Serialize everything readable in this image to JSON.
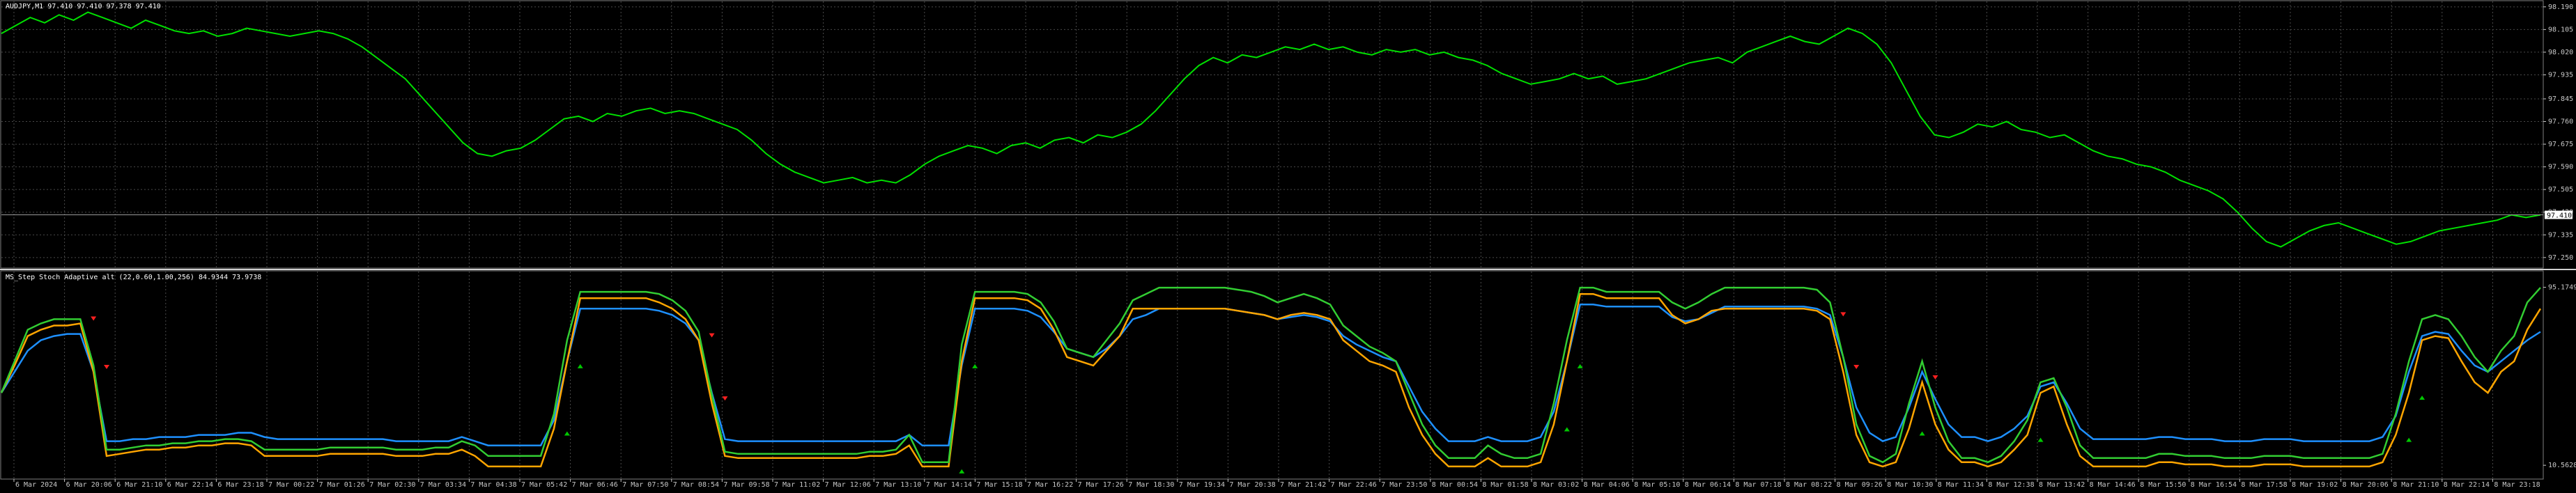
{
  "colors": {
    "background": "#000000",
    "grid": "#4a4a4a",
    "axis_text": "#c8c8c8",
    "price_line": "#00e000",
    "price_marker": "#ffffff",
    "stoch_orange": "#ffa500",
    "stoch_green": "#32cd32",
    "stoch_blue": "#1e90ff",
    "arrow_red": "#ff2020",
    "arrow_green": "#00c800"
  },
  "chart_data": [
    {
      "type": "line",
      "title": "AUDJPY,M1  97.410 97.410 97.378 97.410",
      "symbol": "AUDJPY,M1",
      "ohlc": [
        "97.410",
        "97.410",
        "97.378",
        "97.410"
      ],
      "current_price_label": "97.410",
      "y_ticks": [
        "98.190",
        "98.105",
        "98.020",
        "97.935",
        "97.845",
        "97.760",
        "97.675",
        "97.590",
        "97.505",
        "97.420",
        "97.335",
        "97.250"
      ],
      "ylim": [
        97.213,
        98.2
      ],
      "grid": true,
      "series": [
        {
          "values": [
            98.09,
            98.12,
            98.15,
            98.13,
            98.16,
            98.14,
            98.17,
            98.15,
            98.13,
            98.11,
            98.14,
            98.12,
            98.1,
            98.09,
            98.1,
            98.08,
            98.09,
            98.11,
            98.1,
            98.09,
            98.08,
            98.09,
            98.1,
            98.09,
            98.07,
            98.04,
            98.0,
            97.96,
            97.92,
            97.86,
            97.8,
            97.74,
            97.68,
            97.64,
            97.63,
            97.65,
            97.66,
            97.69,
            97.73,
            97.77,
            97.78,
            97.76,
            97.79,
            97.78,
            97.8,
            97.81,
            97.79,
            97.8,
            97.79,
            97.77,
            97.75,
            97.73,
            97.69,
            97.64,
            97.6,
            97.57,
            97.55,
            97.53,
            97.54,
            97.55,
            97.53,
            97.54,
            97.53,
            97.56,
            97.6,
            97.63,
            97.65,
            97.67,
            97.66,
            97.64,
            97.67,
            97.68,
            97.66,
            97.69,
            97.7,
            97.68,
            97.71,
            97.7,
            97.72,
            97.75,
            97.8,
            97.86,
            97.92,
            97.97,
            98.0,
            97.98,
            98.01,
            98.0,
            98.02,
            98.04,
            98.03,
            98.05,
            98.03,
            98.04,
            98.02,
            98.01,
            98.03,
            98.02,
            98.03,
            98.01,
            98.02,
            98.0,
            97.99,
            97.97,
            97.94,
            97.92,
            97.9,
            97.91,
            97.92,
            97.94,
            97.92,
            97.93,
            97.9,
            97.91,
            97.92,
            97.94,
            97.96,
            97.98,
            97.99,
            98.0,
            97.98,
            98.02,
            98.04,
            98.06,
            98.08,
            98.06,
            98.05,
            98.08,
            98.11,
            98.09,
            98.05,
            97.98,
            97.88,
            97.78,
            97.71,
            97.7,
            97.72,
            97.75,
            97.74,
            97.76,
            97.73,
            97.72,
            97.7,
            97.71,
            97.68,
            97.65,
            97.63,
            97.62,
            97.6,
            97.59,
            97.57,
            97.54,
            97.52,
            97.5,
            97.47,
            97.42,
            97.36,
            97.31,
            97.29,
            97.32,
            97.35,
            97.37,
            97.38,
            97.36,
            97.34,
            97.32,
            97.3,
            97.31,
            97.33,
            97.35,
            97.36,
            97.37,
            97.38,
            97.39,
            97.41,
            97.4,
            97.41
          ]
        }
      ]
    },
    {
      "type": "line",
      "title": "MS_Step Stoch Adaptive alt (22,0.60,1.00,256) 84.9344 73.9738",
      "indicator_name": "MS_Step Stoch Adaptive alt",
      "params": "(22,0.60,1.00,256)",
      "values_label": [
        "84.9344",
        "73.9738"
      ],
      "y_ticks": [
        "95.1749",
        "10.5628"
      ],
      "ylim": [
        4,
        100
      ],
      "grid": true,
      "x_labels": [
        "6 Mar 2024",
        "6 Mar 20:06",
        "6 Mar 21:10",
        "6 Mar 22:14",
        "6 Mar 23:18",
        "7 Mar 00:22",
        "7 Mar 01:26",
        "7 Mar 02:30",
        "7 Mar 03:34",
        "7 Mar 04:38",
        "7 Mar 05:42",
        "7 Mar 06:46",
        "7 Mar 07:50",
        "7 Mar 08:54",
        "7 Mar 09:58",
        "7 Mar 11:02",
        "7 Mar 12:06",
        "7 Mar 13:10",
        "7 Mar 14:14",
        "7 Mar 15:18",
        "7 Mar 16:22",
        "7 Mar 17:26",
        "7 Mar 18:30",
        "7 Mar 19:34",
        "7 Mar 20:38",
        "7 Mar 21:42",
        "7 Mar 22:46",
        "7 Mar 23:50",
        "8 Mar 00:54",
        "8 Mar 01:58",
        "8 Mar 03:02",
        "8 Mar 04:06",
        "8 Mar 05:10",
        "8 Mar 06:14",
        "8 Mar 07:18",
        "8 Mar 08:22",
        "8 Mar 09:26",
        "8 Mar 10:30",
        "8 Mar 11:34",
        "8 Mar 12:38",
        "8 Mar 13:42",
        "8 Mar 14:46",
        "8 Mar 15:50",
        "8 Mar 16:54",
        "8 Mar 17:58",
        "8 Mar 19:02",
        "8 Mar 20:06",
        "8 Mar 21:10",
        "8 Mar 22:14",
        "8 Mar 23:18"
      ],
      "series": [
        {
          "values": [
            45,
            58,
            72,
            75,
            77,
            77,
            78,
            55,
            15,
            16,
            17,
            18,
            18,
            19,
            19,
            20,
            20,
            21,
            21,
            20,
            15,
            15,
            15,
            15,
            15,
            16,
            16,
            16,
            16,
            16,
            15,
            15,
            15,
            16,
            16,
            18,
            15,
            10,
            10,
            10,
            10,
            10,
            28,
            60,
            90,
            90,
            90,
            90,
            90,
            90,
            88,
            85,
            80,
            70,
            40,
            15,
            14,
            14,
            14,
            14,
            14,
            14,
            14,
            14,
            14,
            14,
            15,
            15,
            16,
            20,
            10,
            10,
            10,
            60,
            90,
            90,
            90,
            90,
            89,
            85,
            75,
            62,
            60,
            58,
            65,
            72,
            85,
            85,
            85,
            85,
            85,
            85,
            85,
            85,
            84,
            83,
            82,
            80,
            82,
            83,
            82,
            80,
            70,
            65,
            60,
            58,
            55,
            38,
            25,
            16,
            10,
            10,
            10,
            14,
            10,
            10,
            10,
            12,
            30,
            60,
            92,
            92,
            90,
            90,
            90,
            90,
            90,
            82,
            78,
            80,
            84,
            85,
            85,
            85,
            85,
            85,
            85,
            85,
            84,
            80,
            55,
            25,
            12,
            10,
            12,
            28,
            50,
            30,
            18,
            12,
            12,
            10,
            12,
            18,
            25,
            45,
            48,
            30,
            15,
            10,
            10,
            10,
            10,
            10,
            12,
            12,
            11,
            11,
            11,
            10,
            10,
            10,
            11,
            11,
            11,
            10,
            10,
            10,
            10,
            10,
            10,
            12,
            25,
            45,
            70,
            72,
            71,
            60,
            50,
            45,
            55,
            60,
            75,
            85
          ]
        },
        {
          "values": [
            45,
            60,
            75,
            78,
            80,
            80,
            80,
            58,
            18,
            18,
            19,
            20,
            20,
            21,
            21,
            22,
            22,
            23,
            23,
            22,
            18,
            18,
            18,
            18,
            18,
            19,
            19,
            19,
            19,
            19,
            18,
            18,
            18,
            19,
            19,
            22,
            20,
            15,
            15,
            15,
            15,
            15,
            35,
            70,
            93,
            93,
            93,
            93,
            93,
            93,
            92,
            89,
            84,
            74,
            44,
            17,
            16,
            16,
            16,
            16,
            16,
            16,
            16,
            16,
            16,
            16,
            17,
            17,
            18,
            25,
            12,
            12,
            12,
            68,
            93,
            93,
            93,
            93,
            92,
            88,
            79,
            66,
            64,
            62,
            70,
            78,
            89,
            92,
            95,
            95,
            95,
            95,
            95,
            95,
            94,
            93,
            91,
            88,
            90,
            92,
            90,
            87,
            77,
            72,
            67,
            64,
            60,
            45,
            30,
            20,
            14,
            14,
            14,
            20,
            16,
            14,
            14,
            16,
            40,
            70,
            95,
            95,
            93,
            93,
            93,
            93,
            93,
            88,
            85,
            88,
            92,
            95,
            95,
            95,
            95,
            95,
            95,
            95,
            94,
            88,
            62,
            30,
            15,
            12,
            16,
            40,
            60,
            38,
            22,
            14,
            14,
            12,
            15,
            22,
            32,
            50,
            52,
            38,
            20,
            14,
            14,
            14,
            14,
            14,
            16,
            16,
            15,
            15,
            15,
            14,
            14,
            14,
            15,
            15,
            15,
            14,
            14,
            14,
            14,
            14,
            14,
            16,
            35,
            60,
            80,
            82,
            80,
            72,
            62,
            55,
            65,
            72,
            88,
            95
          ]
        },
        {
          "values": [
            45,
            55,
            65,
            70,
            72,
            73,
            73,
            55,
            22,
            22,
            23,
            23,
            24,
            24,
            24,
            25,
            25,
            25,
            26,
            26,
            24,
            23,
            23,
            23,
            23,
            23,
            23,
            23,
            23,
            23,
            22,
            22,
            22,
            22,
            22,
            24,
            22,
            20,
            20,
            20,
            20,
            20,
            32,
            60,
            85,
            85,
            85,
            85,
            85,
            85,
            84,
            82,
            78,
            70,
            45,
            23,
            22,
            22,
            22,
            22,
            22,
            22,
            22,
            22,
            22,
            22,
            22,
            22,
            22,
            25,
            20,
            20,
            20,
            58,
            85,
            85,
            85,
            85,
            84,
            81,
            74,
            66,
            64,
            62,
            66,
            72,
            80,
            82,
            85,
            85,
            85,
            85,
            85,
            85,
            84,
            83,
            82,
            80,
            81,
            82,
            81,
            79,
            72,
            68,
            65,
            62,
            60,
            48,
            36,
            28,
            22,
            22,
            22,
            24,
            22,
            22,
            22,
            24,
            36,
            60,
            87,
            87,
            86,
            86,
            86,
            86,
            86,
            81,
            79,
            80,
            83,
            86,
            86,
            86,
            86,
            86,
            86,
            86,
            85,
            82,
            62,
            38,
            26,
            22,
            24,
            38,
            55,
            42,
            30,
            24,
            24,
            22,
            24,
            28,
            34,
            48,
            50,
            40,
            28,
            23,
            23,
            23,
            23,
            23,
            24,
            24,
            23,
            23,
            23,
            22,
            22,
            22,
            23,
            23,
            23,
            22,
            22,
            22,
            22,
            22,
            22,
            24,
            34,
            55,
            72,
            74,
            73,
            65,
            58,
            55,
            60,
            65,
            70,
            74
          ]
        }
      ]
    }
  ]
}
